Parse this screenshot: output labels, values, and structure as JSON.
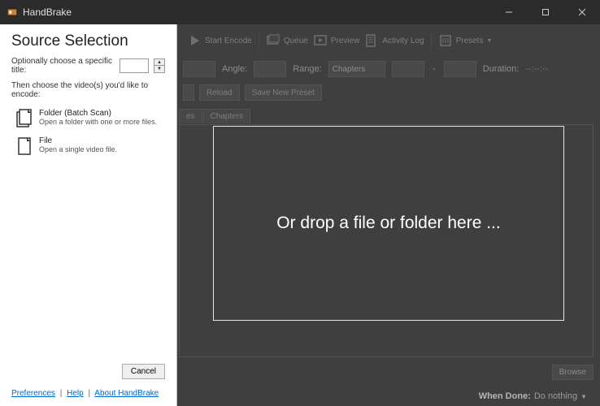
{
  "window": {
    "title": "HandBrake"
  },
  "toolbar": {
    "start_encode": "Start Encode",
    "queue": "Queue",
    "preview": "Preview",
    "activity_log": "Activity Log",
    "presets": "Presets"
  },
  "controls": {
    "angle_label": "Angle:",
    "range_label": "Range:",
    "range_value": "Chapters",
    "dash": "-",
    "duration_label": "Duration:",
    "duration_value": "--:--:--",
    "reload": "Reload",
    "save_new_preset": "Save New Preset"
  },
  "tabs": {
    "t1": "es",
    "t2": "Chapters"
  },
  "footer": {
    "browse": "Browse",
    "when_done_label": "When Done:",
    "when_done_value": "Do nothing"
  },
  "dropzone": {
    "text": "Or drop a file or folder here ..."
  },
  "panel": {
    "title": "Source Selection",
    "opt_label": "Optionally choose a specific title:",
    "instr": "Then choose the video(s) you'd like to encode:",
    "folder_title": "Folder (Batch Scan)",
    "folder_sub": "Open a folder with one or more files.",
    "file_title": "File",
    "file_sub": "Open a single video file.",
    "cancel": "Cancel",
    "pref": "Preferences",
    "help": "Help",
    "about": "About HandBrake"
  }
}
